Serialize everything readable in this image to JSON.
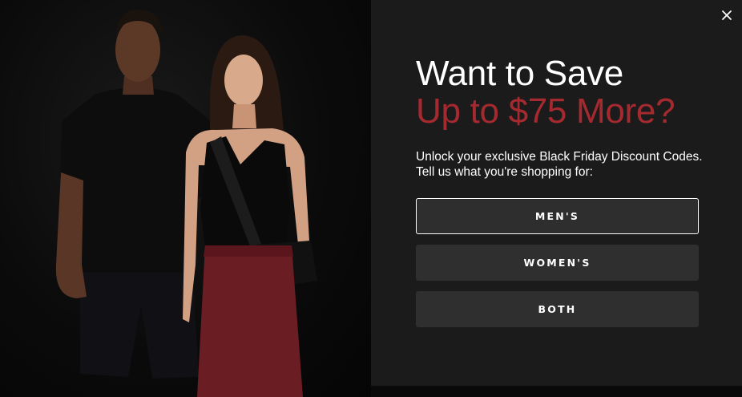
{
  "popup": {
    "close_icon": "close-icon",
    "headline_line1": "Want to Save",
    "headline_line2": "Up to $75 More?",
    "subtext": "Unlock your exclusive Black Friday Discount Codes. Tell us what you're shopping for:",
    "buttons": [
      {
        "label": "MEN'S",
        "focused": true
      },
      {
        "label": "WOMEN'S",
        "focused": false
      },
      {
        "label": "BOTH",
        "focused": false
      }
    ]
  },
  "colors": {
    "accent_red": "#a52a2f",
    "panel_bg": "#1b1b1b",
    "button_bg": "#2f2f2f",
    "text": "#ffffff"
  },
  "image": {
    "subject": "photo-of-man-and-woman-models"
  }
}
